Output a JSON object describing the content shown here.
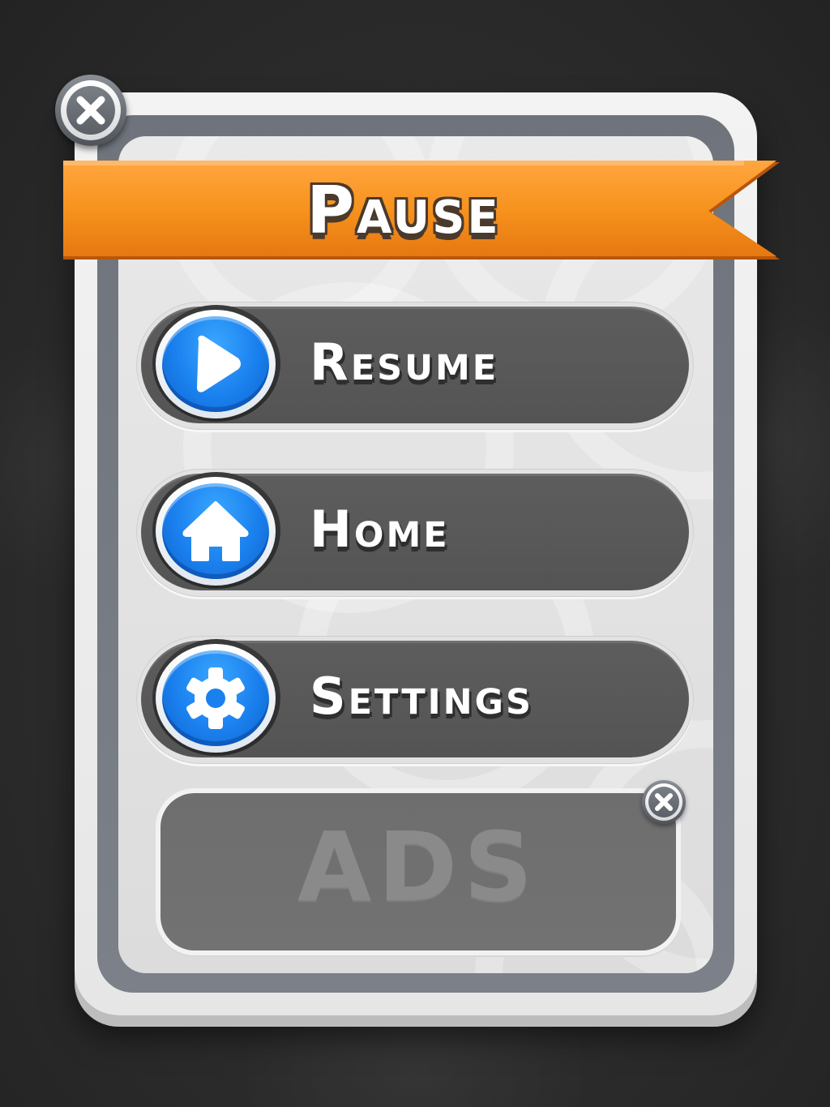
{
  "title": "Pause",
  "close_button": {
    "icon": "close-icon"
  },
  "menu": [
    {
      "id": "resume",
      "label": "Resume",
      "icon": "play-icon"
    },
    {
      "id": "home",
      "label": "Home",
      "icon": "home-icon"
    },
    {
      "id": "settings",
      "label": "Settings",
      "icon": "gear-icon"
    }
  ],
  "ads": {
    "label": "ADS",
    "close_icon": "close-icon"
  },
  "colors": {
    "ribbon": "#f7931e",
    "button_blue": "#1a80ee",
    "button_dark": "#585858",
    "panel": "#e6e6e6",
    "panel_ring": "#73787f"
  }
}
